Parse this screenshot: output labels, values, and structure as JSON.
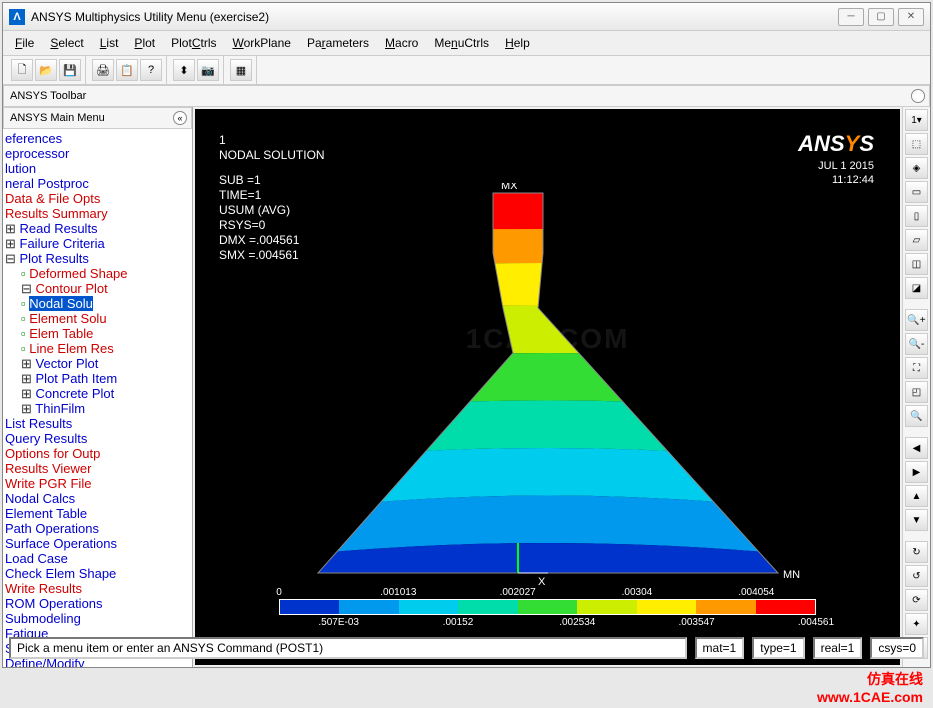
{
  "titlebar": {
    "text": "ANSYS Multiphysics Utility Menu (exercise2)"
  },
  "menubar": [
    "File",
    "Select",
    "List",
    "Plot",
    "PlotCtrls",
    "WorkPlane",
    "Parameters",
    "Macro",
    "MenuCtrls",
    "Help"
  ],
  "toolbar_label": "ANSYS Toolbar",
  "sidebar_title": "ANSYS Main Menu",
  "tree": [
    {
      "t": "eferences",
      "cls": ""
    },
    {
      "t": "eprocessor",
      "cls": ""
    },
    {
      "t": "lution",
      "cls": ""
    },
    {
      "t": "neral Postproc",
      "cls": ""
    },
    {
      "t": "Data & File Opts",
      "cls": "red"
    },
    {
      "t": "Results Summary",
      "cls": "red"
    },
    {
      "t": "Read Results",
      "cls": "plus"
    },
    {
      "t": "Failure Criteria",
      "cls": "plus"
    },
    {
      "t": "Plot Results",
      "cls": "minus"
    },
    {
      "t": "Deformed Shape",
      "cls": "red indent1"
    },
    {
      "t": "Contour Plot",
      "cls": "minus red indent1"
    },
    {
      "t": "Nodal Solu",
      "cls": "selected indent1",
      "sel": true
    },
    {
      "t": "Element Solu",
      "cls": "red indent1"
    },
    {
      "t": "Elem Table",
      "cls": "red indent1"
    },
    {
      "t": "Line Elem Res",
      "cls": "red indent1"
    },
    {
      "t": "Vector Plot",
      "cls": "plus indent1"
    },
    {
      "t": "Plot Path Item",
      "cls": "plus indent1"
    },
    {
      "t": "Concrete Plot",
      "cls": "plus indent1"
    },
    {
      "t": "ThinFilm",
      "cls": "plus indent1"
    },
    {
      "t": "List Results",
      "cls": ""
    },
    {
      "t": "Query Results",
      "cls": ""
    },
    {
      "t": "Options for Outp",
      "cls": "red"
    },
    {
      "t": "Results Viewer",
      "cls": "red"
    },
    {
      "t": "Write PGR File",
      "cls": "red"
    },
    {
      "t": "Nodal Calcs",
      "cls": ""
    },
    {
      "t": "Element Table",
      "cls": ""
    },
    {
      "t": "Path Operations",
      "cls": ""
    },
    {
      "t": "Surface Operations",
      "cls": ""
    },
    {
      "t": "Load Case",
      "cls": ""
    },
    {
      "t": "Check Elem Shape",
      "cls": ""
    },
    {
      "t": "Write Results",
      "cls": "red"
    },
    {
      "t": "ROM Operations",
      "cls": ""
    },
    {
      "t": "Submodeling",
      "cls": ""
    },
    {
      "t": "Fatigue",
      "cls": ""
    },
    {
      "t": "Safety Factor",
      "cls": ""
    },
    {
      "t": "Define/Modify",
      "cls": ""
    }
  ],
  "plot_info": {
    "l0": "1",
    "l1": "NODAL SOLUTION",
    "l2": "SUB =1",
    "l3": "TIME=1",
    "l4": "USUM     (AVG)",
    "l5": "RSYS=0",
    "l6": "DMX =.004561",
    "l7": "SMX =.004561"
  },
  "logo_pre": "ANS",
  "logo_y": "Y",
  "logo_s": "S",
  "date": "JUL  1 2015",
  "time": "11:12:44",
  "mx_label": "MX",
  "mn_label": "MN",
  "x_label": "X",
  "watermark": "1CAE.COM",
  "legend_colors": [
    "#0033cc",
    "#0099ee",
    "#00ccee",
    "#00ddaa",
    "#33dd33",
    "#ccee00",
    "#ffee00",
    "#ff9900",
    "#ff0000"
  ],
  "legend_top": [
    "0",
    ".001013",
    ".002027",
    ".00304",
    ".004054"
  ],
  "legend_bot": [
    ".507E-03",
    ".00152",
    ".002534",
    ".003547",
    ".004561"
  ],
  "bottom_prompt": "Pick a menu item or enter an ANSYS Command (POST1)",
  "status": {
    "mat": "mat=1",
    "type": "type=1",
    "real": "real=1",
    "csys": "csys=0"
  },
  "overlay": {
    "l1": "仿真在线",
    "l2": "www.1CAE.com"
  },
  "right_dropdown": "1"
}
